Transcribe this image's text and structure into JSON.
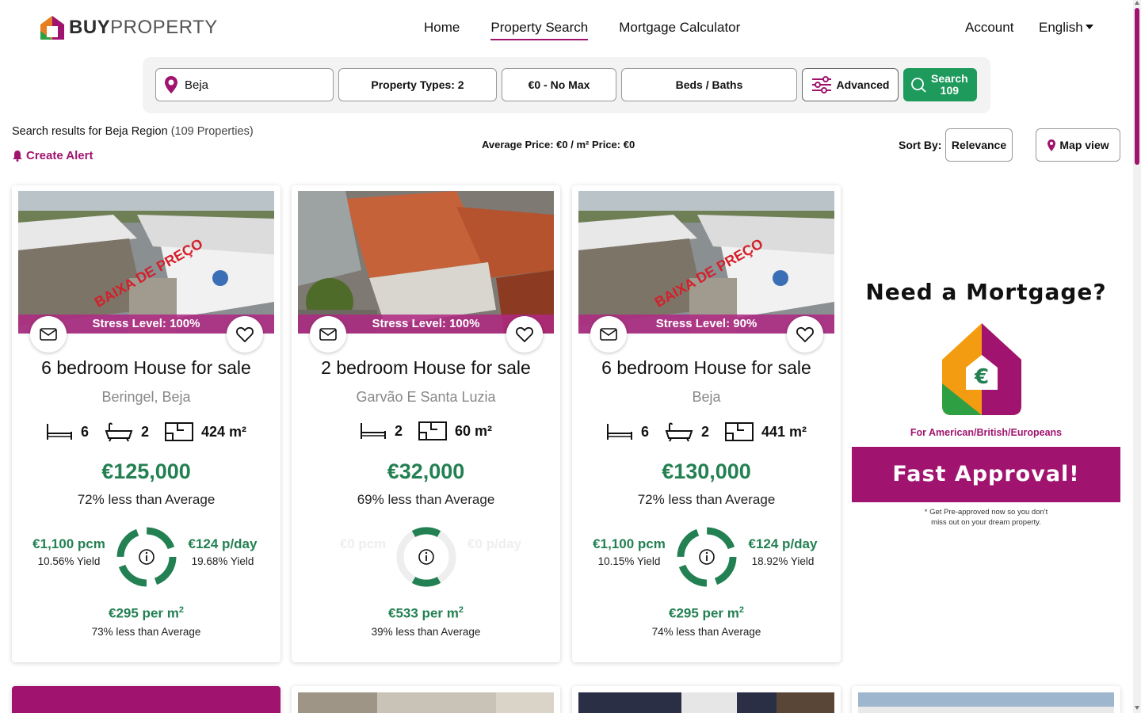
{
  "header": {
    "logo_bold": "BUY",
    "logo_light": "PROPERTY",
    "nav": [
      {
        "label": "Home"
      },
      {
        "label": "Property Search"
      },
      {
        "label": "Mortgage Calculator"
      }
    ],
    "account": "Account",
    "language": "English"
  },
  "search": {
    "location": "Beja",
    "property_types": "Property Types: 2",
    "price": "€0 - No Max",
    "beds_baths": "Beds / Baths",
    "advanced": "Advanced",
    "button_line1": "Search",
    "button_line2": "109"
  },
  "results": {
    "text": "Search results for Beja Region",
    "count": "(109 Properties)",
    "create_alert": "Create Alert",
    "average": "Average Price: €0 / m² Price: €0",
    "sort_label": "Sort By:",
    "sort_value": "Relevance",
    "map_view": "Map view"
  },
  "listings": [
    {
      "stress": "Stress Level: 100%",
      "overlay": "BAIXA DE PREÇO",
      "title": "6 bedroom House for sale",
      "location": "Beringel, Beja",
      "beds": "6",
      "baths": "2",
      "area": "424 m²",
      "price": "€125,000",
      "less": "72% less than Average",
      "rent_pcm": "€1,100 pcm",
      "yield_pcm": "10.56% Yield",
      "rent_day": "€124 p/day",
      "yield_day": "19.68% Yield",
      "per_m2": "€295 per m",
      "per_m2_less": "73% less than Average"
    },
    {
      "stress": "Stress Level: 100%",
      "overlay": "",
      "title": "2 bedroom House for sale",
      "location": "Garvão E Santa Luzia",
      "beds": "2",
      "baths": "",
      "area": "60 m²",
      "price": "€32,000",
      "less": "69% less than Average",
      "rent_pcm": "€0 pcm",
      "yield_pcm": "",
      "rent_day": "€0 p/day",
      "yield_day": "",
      "per_m2": "€533 per m",
      "per_m2_less": "39% less than Average"
    },
    {
      "stress": "Stress Level: 90%",
      "overlay": "BAIXA DE PREÇO",
      "title": "6 bedroom House for sale",
      "location": "Beja",
      "beds": "6",
      "baths": "2",
      "area": "441 m²",
      "price": "€130,000",
      "less": "72% less than Average",
      "rent_pcm": "€1,100 pcm",
      "yield_pcm": "10.15% Yield",
      "rent_day": "€124 p/day",
      "yield_day": "18.92% Yield",
      "per_m2": "€295 per m",
      "per_m2_less": "74% less than Average"
    }
  ],
  "ad": {
    "title": "Need a Mortgage?",
    "subtitle": "For American/British/Europeans",
    "button": "Fast Approval!",
    "note_line1": "* Get Pre-approved now so you don't",
    "note_line2": "miss out on your dream property."
  },
  "colors": {
    "brand": "#a0146f",
    "green": "#238052",
    "search_button": "#1e9a5c"
  }
}
